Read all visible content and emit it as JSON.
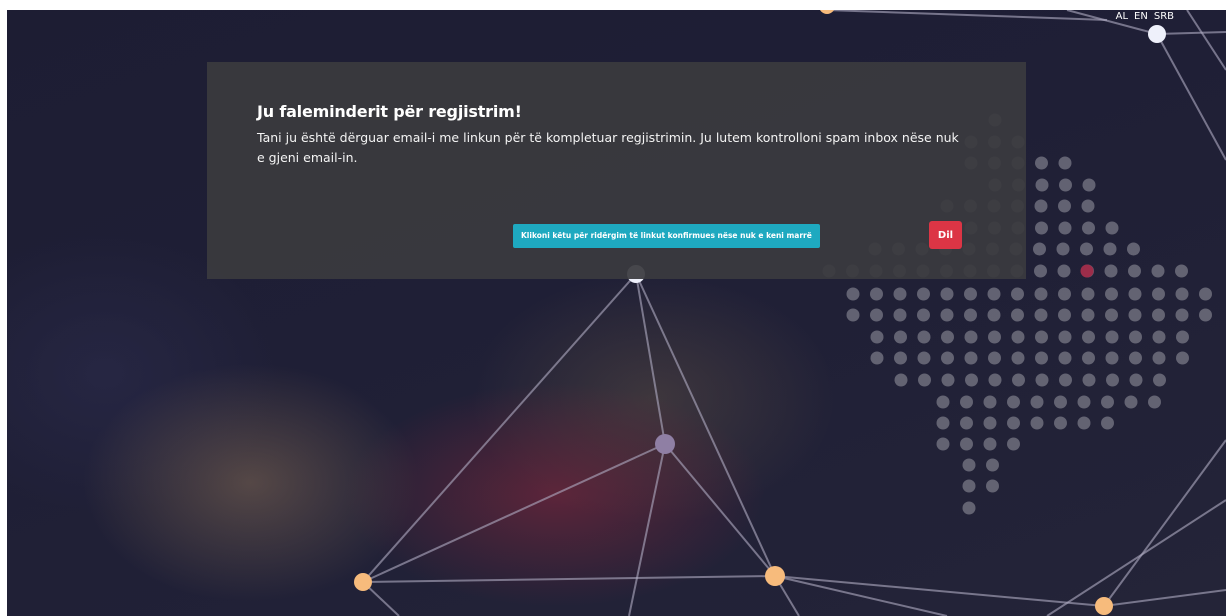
{
  "language_switch": [
    "AL",
    "EN",
    "SRB"
  ],
  "card": {
    "title": "Ju faleminderit për regjistrim!",
    "message": "Tani ju është dërguar email-i me linkun për të kompletuar regjistrimin. Ju lutem kontrolloni spam inbox nëse nuk e gjeni email-in."
  },
  "actions": {
    "resend_label": "Klikoni këtu për ridërgim të linkut konfirmues nëse nuk e keni marrë",
    "logout_label": "Dil"
  },
  "colors": {
    "resend_button": "#1ea9c0",
    "logout_button": "#dc3545",
    "network_node_orange": "#f7bb7c",
    "network_node_white": "#eef0fb",
    "network_node_lilac": "#8f7fa4",
    "dot_grid": "#6e6e7c",
    "dot_highlight": "#9c2d4a"
  }
}
